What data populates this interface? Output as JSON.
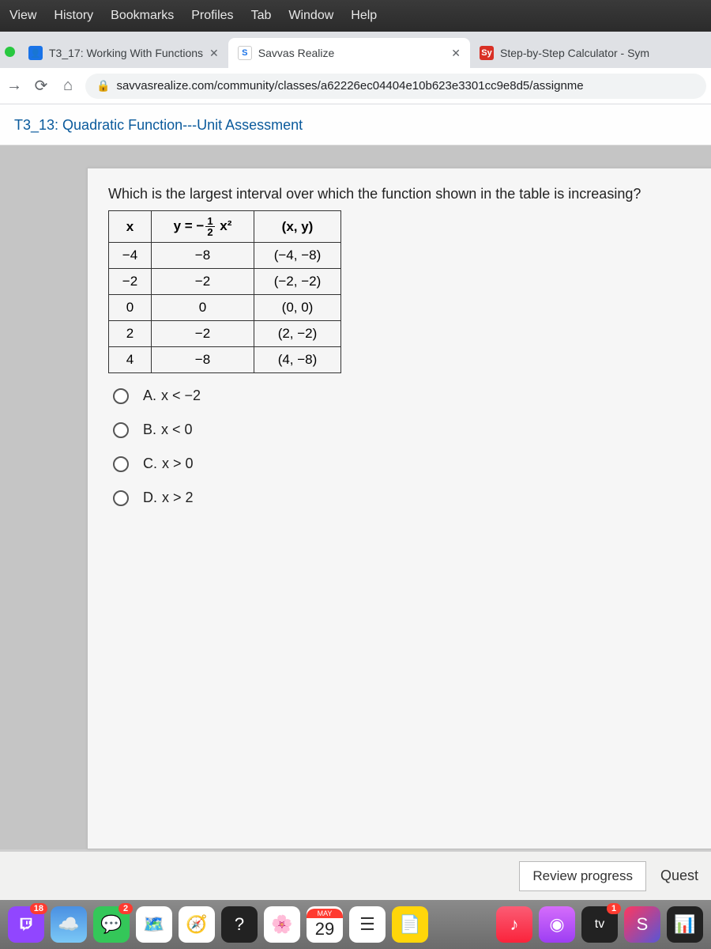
{
  "mac_menu": [
    "View",
    "History",
    "Bookmarks",
    "Profiles",
    "Tab",
    "Window",
    "Help"
  ],
  "tabs": {
    "t0": {
      "title": "T3_17: Working With Functions",
      "favicon_bg": "#1a73e8",
      "favicon_txt": "👤",
      "active": false
    },
    "t1": {
      "title": "Savvas Realize",
      "favicon_bg": "#ffffff",
      "favicon_txt": "S",
      "favicon_color": "#1a73e8",
      "active": true
    },
    "t2": {
      "title": "Step-by-Step Calculator - Sym",
      "favicon_bg": "#d93025",
      "favicon_txt": "Sy",
      "active": false
    }
  },
  "address": {
    "url": "savvasrealize.com/community/classes/a62226ec04404e10b623e3301cc9e8d5/assignme"
  },
  "page": {
    "breadcrumb": "T3_13: Quadratic Function---Unit Assessment"
  },
  "question": {
    "prompt": "Which is the largest interval over which the function shown in the table is increasing?",
    "table": {
      "headers": {
        "c0": "x",
        "c1_pre": "y = −",
        "c1_num": "1",
        "c1_den": "2",
        "c1_post": " x²",
        "c2": "(x, y)"
      },
      "rows": [
        {
          "c0": "−4",
          "c1": "−8",
          "c2": "(−4, −8)"
        },
        {
          "c0": "−2",
          "c1": "−2",
          "c2": "(−2, −2)"
        },
        {
          "c0": "0",
          "c1": "0",
          "c2": "(0, 0)"
        },
        {
          "c0": "2",
          "c1": "−2",
          "c2": "(2, −2)"
        },
        {
          "c0": "4",
          "c1": "−8",
          "c2": "(4, −8)"
        }
      ]
    },
    "options": [
      {
        "letter": "A.",
        "text": "x < −2"
      },
      {
        "letter": "B.",
        "text": "x < 0"
      },
      {
        "letter": "C.",
        "text": "x > 0"
      },
      {
        "letter": "D.",
        "text": "x > 2"
      }
    ]
  },
  "footer": {
    "review": "Review progress",
    "quest": "Quest"
  },
  "dock": {
    "twitch_badge": "18",
    "msg_badge": "2",
    "cal_month": "MAY",
    "cal_day": "29",
    "tv_label": "tv",
    "tv_badge": "1"
  }
}
